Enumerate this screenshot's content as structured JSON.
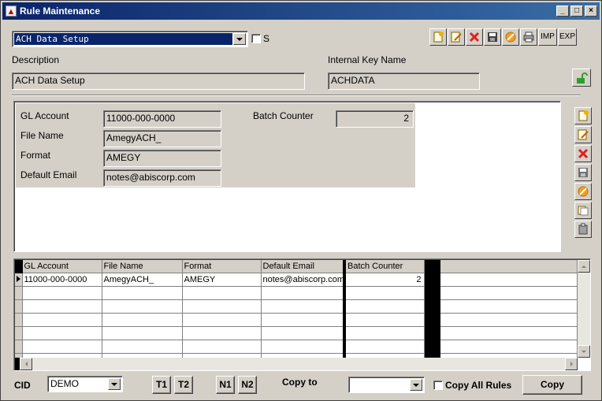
{
  "window": {
    "title": "Rule Maintenance"
  },
  "rule_select": {
    "value": "ACH Data Setup"
  },
  "s_checkbox": {
    "label": "S",
    "checked": false
  },
  "toolbar": {
    "imp_label": "IMP",
    "exp_label": "EXP"
  },
  "header": {
    "description_label": "Description",
    "description_value": "ACH Data Setup",
    "internal_key_label": "Internal Key Name",
    "internal_key_value": "ACHDATA"
  },
  "details": {
    "gl_account_label": "GL Account",
    "gl_account_value": "11000-000-0000",
    "file_name_label": "File Name",
    "file_name_value": "AmegyACH_",
    "format_label": "Format",
    "format_value": "AMEGY",
    "default_email_label": "Default Email",
    "default_email_value": "notes@abiscorp.com",
    "batch_counter_label": "Batch Counter",
    "batch_counter_value": "2"
  },
  "grid": {
    "columns": [
      "GL Account",
      "File Name",
      "Format",
      "Default Email",
      "Batch Counter"
    ],
    "rows": [
      [
        "11000-000-0000",
        "AmegyACH_",
        "AMEGY",
        "notes@abiscorp.com",
        "2"
      ]
    ]
  },
  "footer": {
    "cid_label": "CID",
    "cid_value": "DEMO",
    "t1": "T1",
    "t2": "T2",
    "n1": "N1",
    "n2": "N2",
    "copy_to_label": "Copy to",
    "copy_to_value": "",
    "copy_all_label": "Copy All Rules",
    "copy_button": "Copy"
  },
  "colors": {
    "title_start": "#0a246a",
    "title_end": "#3a6ea5",
    "face": "#d4d0c8",
    "unlock_green": "#2e9e2e"
  }
}
